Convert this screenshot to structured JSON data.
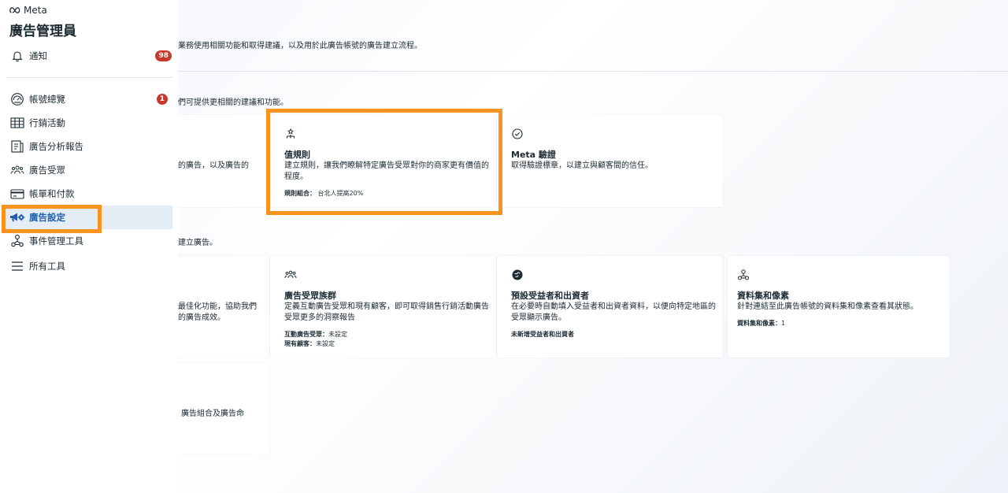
{
  "sidebar": {
    "brand": "Meta",
    "app_title": "廣告管理員",
    "notifications": {
      "label": "通知",
      "badge": "98"
    },
    "items": [
      {
        "label": "帳號總覽",
        "badge": "1",
        "icon": "speedometer-icon"
      },
      {
        "label": "行銷活動",
        "icon": "table-icon"
      },
      {
        "label": "廣告分析報告",
        "icon": "report-icon"
      },
      {
        "label": "廣告受眾",
        "icon": "audience-icon"
      },
      {
        "label": "帳單和付款",
        "icon": "credit-card-icon"
      },
      {
        "label": "廣告設定",
        "icon": "megaphone-gear-icon",
        "active": true
      },
      {
        "label": "事件管理工具",
        "icon": "events-manager-icon"
      },
      {
        "label": "所有工具",
        "icon": "menu-icon"
      }
    ]
  },
  "main": {
    "intro": "業務使用相關功能和取得建議，以及用於此廣告帳號的廣告建立流程。",
    "section1_text": "們可提供更相關的建議和功能。",
    "section2_text": "建立廣告。",
    "cards": {
      "partial1_text": "的廣告，以及廣告的",
      "value_rules": {
        "title": "值規則",
        "desc": "建立規則，讓我們瞭解特定廣告受眾對你的商家更有價值的程度。",
        "meta_label": "規則組合：",
        "meta_value": "台北人提高20%"
      },
      "meta_verified": {
        "title": "Meta 驗證",
        "desc": "取得驗證標章，以建立與顧客間的信任。"
      },
      "partial2_line1": "最佳化功能，協助我們",
      "partial2_line2": "的廣告成效。",
      "audience_segments": {
        "title": "廣告受眾族群",
        "desc": "定義互動廣告受眾和現有顧客，即可取得銷售行銷活動廣告受眾更多的洞察報告",
        "meta1_label": "互動廣告受眾：",
        "meta1_value": "未設定",
        "meta2_label": "現有顧客：",
        "meta2_value": "未設定"
      },
      "beneficiary": {
        "title": "預設受益者和出資者",
        "desc": "在必要時自動填入受益者和出資者資料，以便向特定地區的受眾顯示廣告。",
        "meta": "未新增受益者和出資者"
      },
      "datasets": {
        "title": "資料集和像素",
        "desc": "針對連結至此廣告帳號的資料集和像素查看其狀態。",
        "meta_label": "資料集和像素：",
        "meta_value": "1"
      },
      "partial3_text": "廣告組合及廣告命"
    }
  },
  "colors": {
    "highlight": "#f7931e",
    "active_bg": "#e4ecf6",
    "active_text": "#1f5fae",
    "badge": "#c8392b"
  }
}
